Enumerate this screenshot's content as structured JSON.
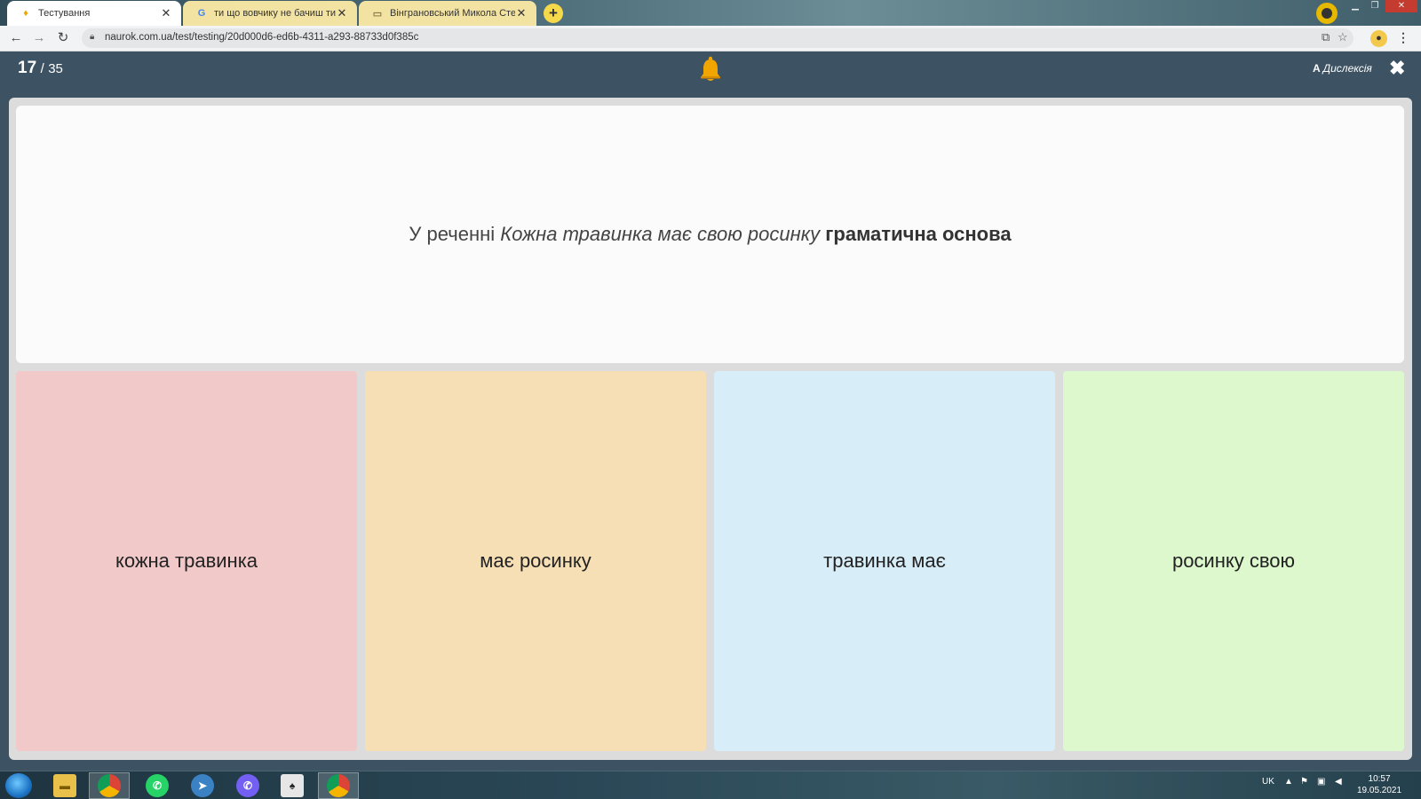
{
  "browser": {
    "tabs": [
      {
        "title": "Тестування",
        "favicon": "bell-favicon",
        "active": true
      },
      {
        "title": "ти що вовчику не бачиш ти слі",
        "favicon": "google-g",
        "active": false
      },
      {
        "title": "Вінграновський Микола Степан",
        "favicon": "book-favicon",
        "active": false
      }
    ],
    "url": "naurok.com.ua/test/testing/20d000d6-ed6b-4311-a293-88733d0f385c"
  },
  "header": {
    "current_question": "17",
    "separator": "/",
    "total_questions": "35",
    "dyslexia_icon_letter": "A",
    "dyslexia_label": "Дислексія"
  },
  "question": {
    "prefix": "У реченні",
    "sentence": "Кожна травинка має свою росинку",
    "suffix": "граматична основа"
  },
  "answers": [
    {
      "label": "кожна травинка",
      "color": "#f2c9c9"
    },
    {
      "label": "має росинку",
      "color": "#f7dfb5"
    },
    {
      "label": "травинка має",
      "color": "#d7edf7"
    },
    {
      "label": "росинку свою",
      "color": "#dcf8cc"
    }
  ],
  "taskbar": {
    "language": "UK",
    "time": "10:57",
    "date": "19.05.2021"
  },
  "colors": {
    "header_bg": "#3d5262",
    "bell": "#f0a500"
  }
}
